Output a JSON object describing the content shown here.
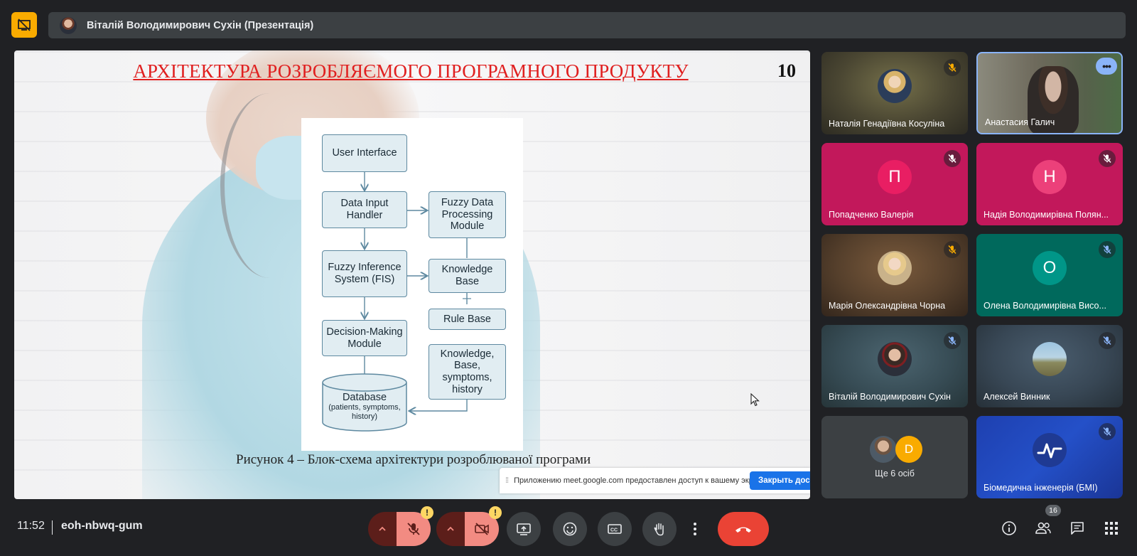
{
  "header": {
    "presenter_title": "Віталій Володимирович Сухін (Презентація)"
  },
  "slide": {
    "title": "АРХІТЕКТУРА РОЗРОБЛЯЄМОГО ПРОГРАМНОГО ПРОДУКТУ",
    "number": "10",
    "caption": "Рисунок 4 – Блок-схема архітектури розроблюваної програми",
    "diagram": {
      "user_interface": "User Interface",
      "data_input_handler": "Data Input Handler",
      "fuzzy_data_processing": "Fuzzy Data Processing Module",
      "fis": "Fuzzy Inference System (FIS)",
      "knowledge_base": "Knowledge Base",
      "rule_base": "Rule Base",
      "decision_making": "Decision-Making Module",
      "kb_symptoms": "Knowledge, Base, symptoms, history",
      "database_title": "Database",
      "database_sub": "(patients, symptoms, history)"
    },
    "share_notice": "Приложению meet.google.com предоставлен доступ к вашему экрану.",
    "share_stop": "Закрыть доступ"
  },
  "participants": [
    {
      "name": "Наталія Генадіївна Косуліна",
      "avatar": "photo",
      "muted": true
    },
    {
      "name": "Анастасия Галич",
      "avatar": "video",
      "muted": false
    },
    {
      "name": "Попадченко Валерія",
      "avatar": "letter",
      "letter": "П",
      "muted": true
    },
    {
      "name": "Надія Володимирівна Полян...",
      "avatar": "letter",
      "letter": "Н",
      "muted": true
    },
    {
      "name": "Марія Олександрівна Чорна",
      "avatar": "photo",
      "muted": true
    },
    {
      "name": "Олена Володимирівна Висо...",
      "avatar": "letter",
      "letter": "О",
      "muted": true
    },
    {
      "name": "Віталій Володимирович Сухін",
      "avatar": "photo",
      "muted": true
    },
    {
      "name": "Алексей Винник",
      "avatar": "photo",
      "muted": true
    },
    {
      "name": "Біомедична інженерія (БМІ)",
      "avatar": "logo",
      "muted": true
    }
  ],
  "others": {
    "label": "Ще 6 осіб",
    "letter": "D"
  },
  "footer": {
    "time": "11:52",
    "meeting_code": "eoh-nbwq-gum",
    "people_count": "16",
    "warning_mark": "!"
  },
  "colors": {
    "accent": "#8ab4f8",
    "end_call": "#ea4335",
    "present_badge": "#f9ab00",
    "mic_off_bg": "#f28b82",
    "slide_title": "#e02020"
  }
}
